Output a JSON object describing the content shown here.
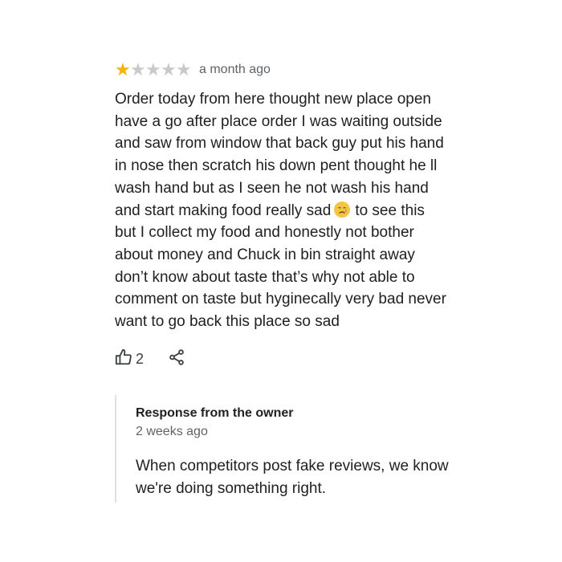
{
  "review": {
    "rating": 1,
    "max_rating": 5,
    "star_filled_color": "#f4b400",
    "star_empty_color": "#c9c9c9",
    "time": "a month ago",
    "text_before_emoji": "Order today from here thought new place open\nhave a go after place order I was waiting outside\nand saw from window that back guy put his hand\nin nose then scratch his down pent thought he ll\nwash hand but as I seen he not wash his hand\nand start making food really sad",
    "emoji": "crying-face-emoji",
    "text_after_emoji": "to see this\nbut I collect my food and honestly not bother\nabout money and Chuck in bin straight away\ndon’t know about taste that’s why not able to\ncomment on taste but hyginecally very bad never\nwant to go back this place so sad"
  },
  "actions": {
    "like_icon": "thumbs-up-icon",
    "like_count": "2",
    "share_icon": "share-icon"
  },
  "owner_response": {
    "title": "Response from the owner",
    "time": "2 weeks ago",
    "text": "When competitors post fake reviews, we know\nwe're doing something right."
  }
}
